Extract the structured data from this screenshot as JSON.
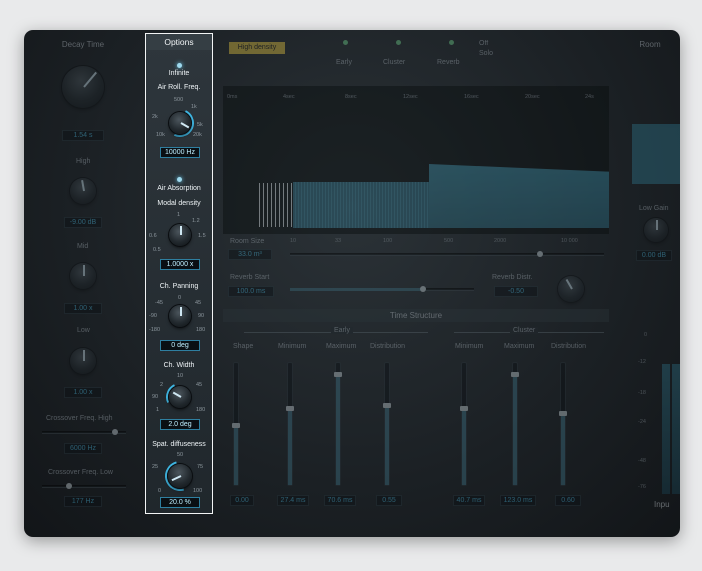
{
  "left_panel": {
    "title": "Decay Time",
    "main_value": "1.54 s",
    "high_label": "High",
    "high_value": "-9.00 dB",
    "mid_label": "Mid",
    "mid_value": "1.00 x",
    "low_label": "Low",
    "low_value": "1.00 x",
    "crossover_high_label": "Crossover Freq. High",
    "crossover_high_value": "6000 Hz",
    "crossover_low_label": "Crossover Freq. Low",
    "crossover_low_value": "177 Hz"
  },
  "options_panel": {
    "title": "Options",
    "infinite_label": "Infinite",
    "air_roll_label": "Air Roll. Freq.",
    "air_roll_value": "10000 Hz",
    "air_roll_ticks": [
      "500",
      "1k",
      "2k",
      "5k",
      "10k",
      "20k"
    ],
    "air_absorption_label": "Air Absorption",
    "modal_density_label": "Modal density",
    "modal_density_value": "1.0000 x",
    "modal_ticks": [
      "1",
      "1.2",
      "0.6",
      "1.5",
      "0.5"
    ],
    "ch_panning_label": "Ch. Panning",
    "ch_panning_value": "0 deg",
    "pan_ticks": [
      "0",
      "-45",
      "45",
      "-90",
      "90",
      "-180",
      "180"
    ],
    "ch_width_label": "Ch. Width",
    "ch_width_value": "2.0 deg",
    "width_ticks": [
      "10",
      "2",
      "45",
      "90",
      "1",
      "180"
    ],
    "spat_diffuseness_label": "Spat. diffuseness",
    "spat_diffuseness_value": "20.0 %",
    "spat_ticks": [
      "50",
      "25",
      "75",
      "0",
      "100"
    ]
  },
  "top_bar": {
    "density_badge": "High density",
    "early_label": "Early",
    "cluster_label": "Cluster",
    "reverb_label": "Reverb",
    "solo_label": "Solo",
    "off_label": "Off"
  },
  "graph": {
    "time_ticks": [
      "0ms",
      "4sec",
      "8sec",
      "12sec",
      "16sec",
      "20sec",
      "24s"
    ]
  },
  "room": {
    "room_size_label": "Room Size",
    "room_size_value": "33.0 m³",
    "room_ticks": [
      "10",
      "33",
      "100",
      "500",
      "2000",
      "10 000"
    ],
    "reverb_start_label": "Reverb Start",
    "reverb_start_value": "100.0 ms",
    "reverb_distr_label": "Reverb Distr.",
    "reverb_distr_value": "-0.50"
  },
  "time_structure": {
    "title": "Time Structure",
    "early_title": "Early",
    "cluster_title": "Cluster",
    "columns": [
      "Shape",
      "Minimum",
      "Maximum",
      "Distribution",
      "Minimum",
      "Maximum",
      "Distribution"
    ],
    "slider_levels": [
      0.48,
      0.62,
      0.9,
      0.65,
      0.62,
      0.9,
      0.58
    ],
    "values": [
      "0.00",
      "27.4 ms",
      "70.6 ms",
      "0.55",
      "40.7 ms",
      "123.0 ms",
      "0.60"
    ]
  },
  "right_panel": {
    "title": "Room",
    "low_gain_label": "Low Gain",
    "low_gain_value": "0.00 dB",
    "meter_ticks": [
      "0",
      "-12",
      "-18",
      "-24",
      "-48",
      "-76"
    ],
    "input_label": "Inpu"
  },
  "colors": {
    "accent": "#49b8df",
    "graph_fill": "#2f6e84",
    "highlight_border": "#f2f4f5",
    "badge": "#e2c342"
  }
}
